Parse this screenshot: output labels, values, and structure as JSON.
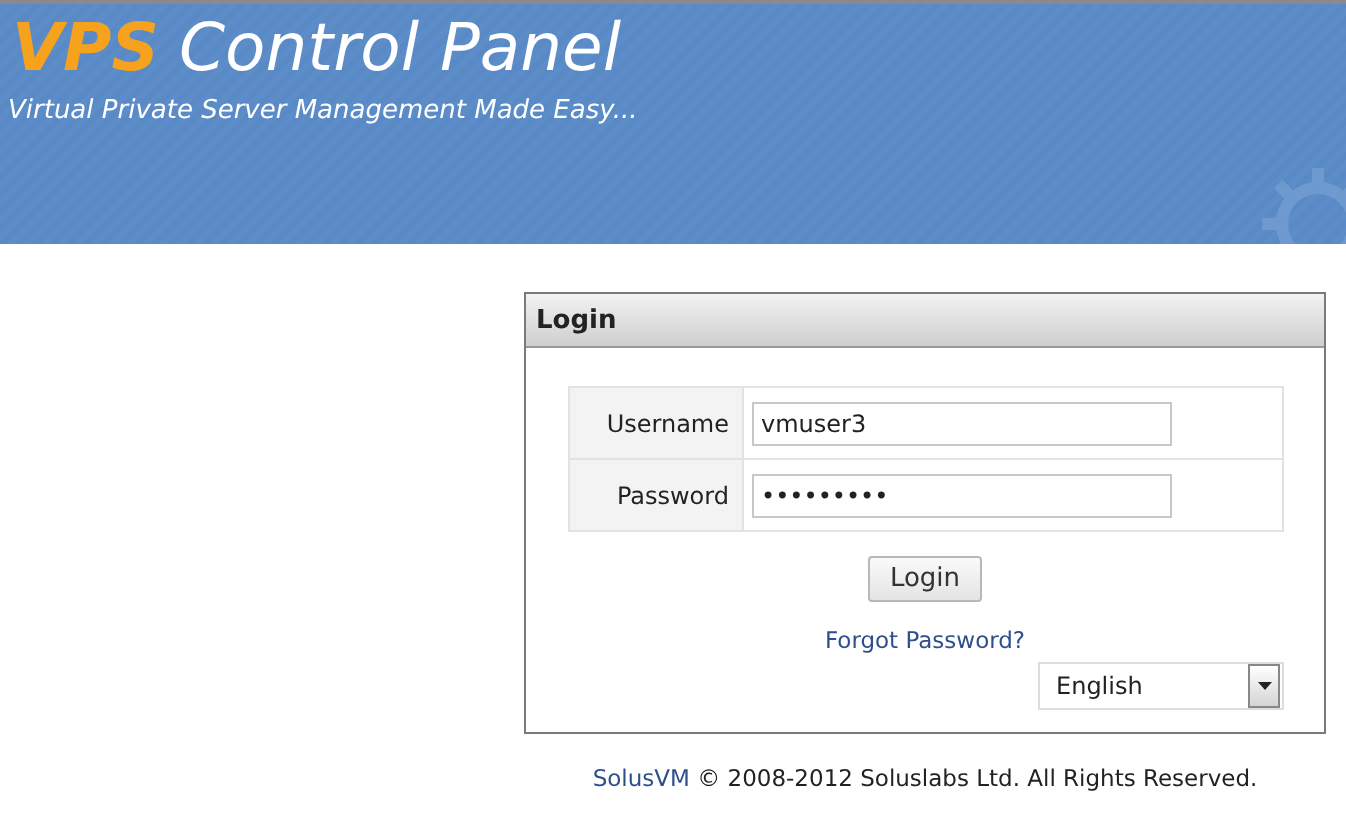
{
  "header": {
    "brand": "VPS",
    "title": "Control Panel",
    "tagline": "Virtual Private Server Management Made Easy..."
  },
  "login": {
    "title": "Login",
    "fields": [
      {
        "label": "Username",
        "value": "vmuser3"
      },
      {
        "label": "Password",
        "value": "•••••••••"
      }
    ],
    "button": "Login",
    "forgot_link": "Forgot Password?",
    "language": "English"
  },
  "footer": {
    "link": "SolusVM",
    "text": "© 2008-2012 Soluslabs Ltd. All Rights Reserved."
  }
}
